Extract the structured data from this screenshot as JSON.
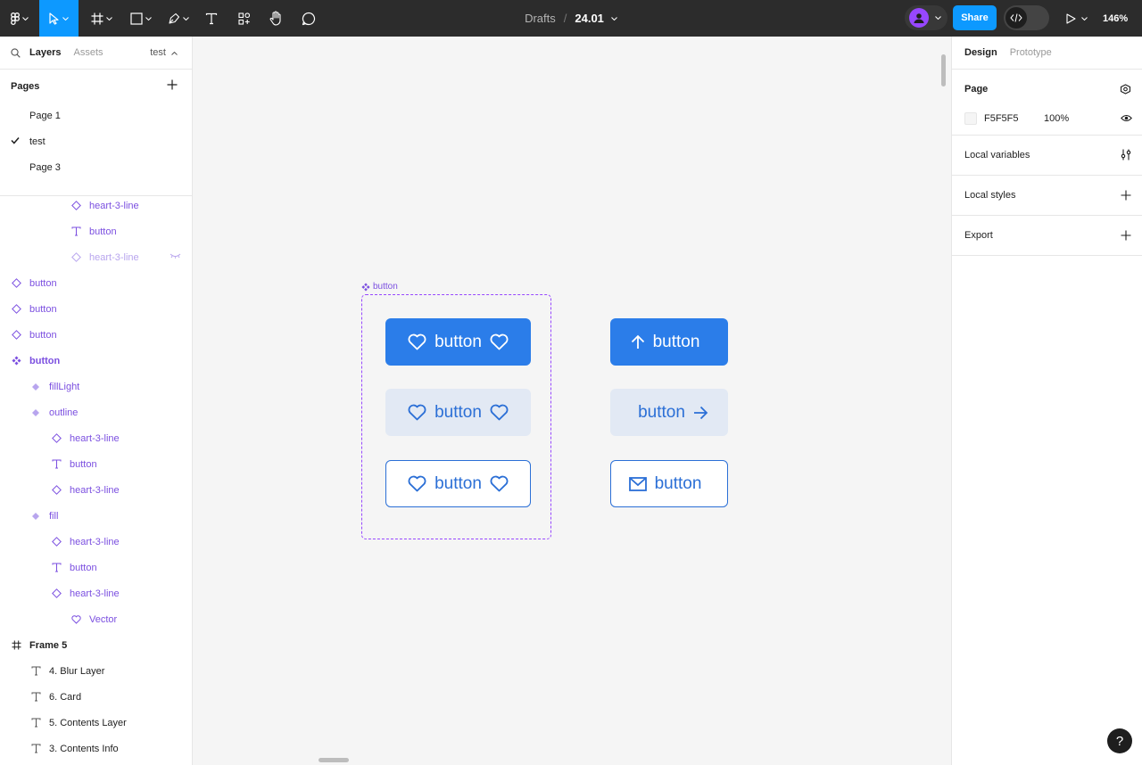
{
  "toolbar": {
    "breadcrumb": "Drafts",
    "separator": "/",
    "file_name": "24.01",
    "share_label": "Share",
    "zoom": "146%"
  },
  "left_panel": {
    "tabs": [
      "Layers",
      "Assets"
    ],
    "current_page": "test",
    "pages_title": "Pages",
    "pages": [
      {
        "name": "Page 1",
        "selected": false
      },
      {
        "name": "test",
        "selected": true
      },
      {
        "name": "Page 3",
        "selected": false
      }
    ],
    "layers": [
      {
        "name": "heart-3-line",
        "icon": "instance-icon"
      },
      {
        "name": "button",
        "icon": "text-icon"
      },
      {
        "name": "heart-3-line",
        "icon": "instance-icon",
        "hidden": true
      },
      {
        "name": "button",
        "icon": "instance-icon"
      },
      {
        "name": "button",
        "icon": "instance-icon"
      },
      {
        "name": "button",
        "icon": "instance-icon"
      },
      {
        "name": "button",
        "icon": "component-set-icon"
      },
      {
        "name": "fillLight",
        "icon": "variant-icon"
      },
      {
        "name": "outline",
        "icon": "variant-icon"
      },
      {
        "name": "heart-3-line",
        "icon": "instance-icon"
      },
      {
        "name": "button",
        "icon": "text-icon"
      },
      {
        "name": "heart-3-line",
        "icon": "instance-icon"
      },
      {
        "name": "fill",
        "icon": "variant-icon"
      },
      {
        "name": "heart-3-line",
        "icon": "instance-icon"
      },
      {
        "name": "button",
        "icon": "text-icon"
      },
      {
        "name": "heart-3-line",
        "icon": "instance-icon"
      },
      {
        "name": "Vector",
        "icon": "vector-icon"
      },
      {
        "name": "Frame 5",
        "icon": "frame-icon"
      },
      {
        "name": "4. Blur Layer",
        "icon": "text-icon"
      },
      {
        "name": "6. Card",
        "icon": "text-icon"
      },
      {
        "name": "5. Contents Layer",
        "icon": "text-icon"
      },
      {
        "name": "3. Contents Info",
        "icon": "text-icon"
      }
    ]
  },
  "canvas": {
    "component_label": "button",
    "buttons": [
      {
        "label": "button",
        "variant": "fill",
        "icon_left": "heart-icon",
        "icon_right": "heart-icon"
      },
      {
        "label": "button",
        "variant": "fillLight",
        "icon_left": "heart-icon",
        "icon_right": "heart-icon"
      },
      {
        "label": "button",
        "variant": "outline",
        "icon_left": "heart-icon",
        "icon_right": "heart-icon"
      },
      {
        "label": "button",
        "variant": "fill",
        "icon_left": "arrow-up-icon"
      },
      {
        "label": "button",
        "variant": "fillLight",
        "icon_right": "arrow-right-icon"
      },
      {
        "label": "button",
        "variant": "outline",
        "icon_left": "mail-icon"
      }
    ]
  },
  "right_panel": {
    "tabs": [
      "Design",
      "Prototype"
    ],
    "page_title": "Page",
    "page_color": "F5F5F5",
    "page_opacity": "100%",
    "local_variables": "Local variables",
    "local_styles": "Local styles",
    "export": "Export"
  },
  "colors": {
    "accent": "#0d99ff",
    "component_purple": "#9747ff",
    "button_fill": "#2b7de9",
    "button_light": "#e2e9f4"
  }
}
